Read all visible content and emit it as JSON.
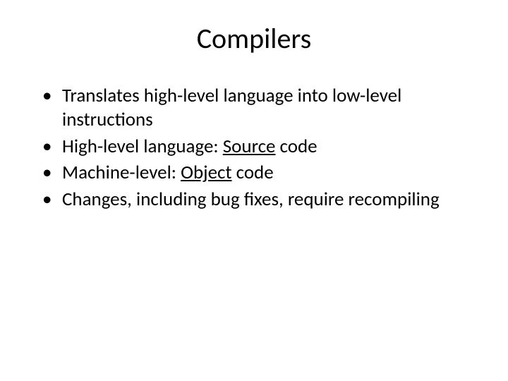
{
  "title": "Compilers",
  "bullets": [
    {
      "text": "Translates high-level language into low-level instructions"
    },
    {
      "prefix": "High-level language:  ",
      "u": "Source",
      "suffix": " code"
    },
    {
      "prefix": "Machine-level:  ",
      "u": "Object",
      "suffix": " code"
    },
    {
      "text": "Changes, including bug fixes, require recompiling"
    }
  ]
}
